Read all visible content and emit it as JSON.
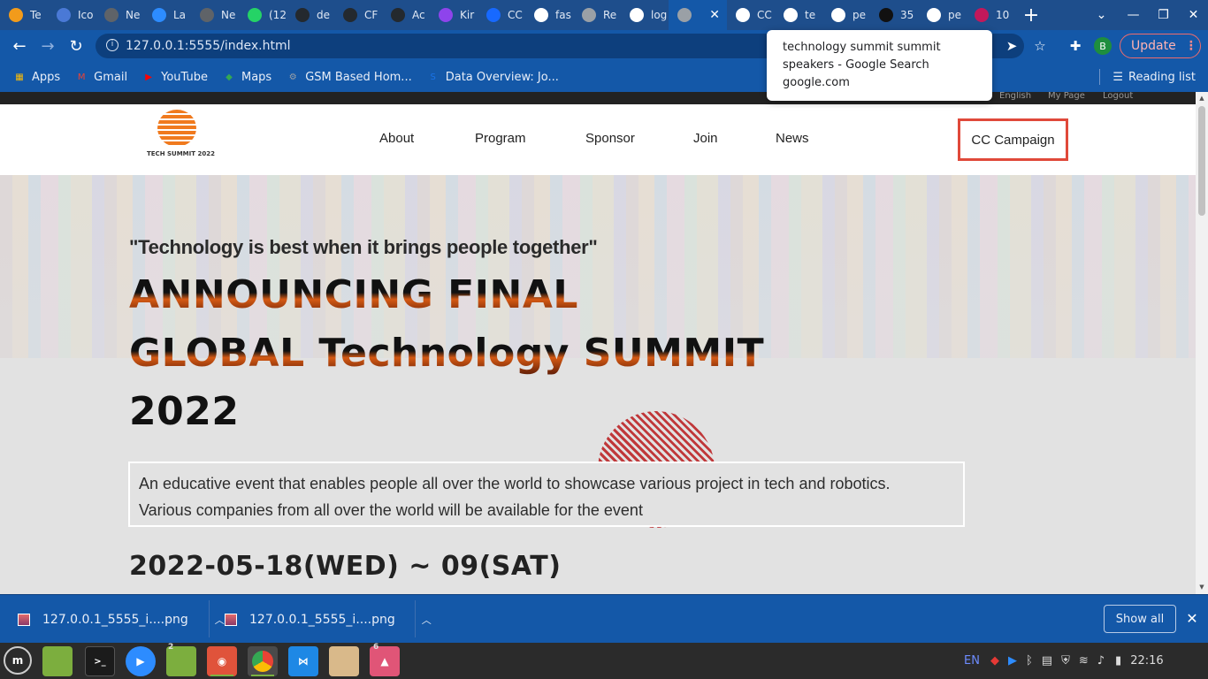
{
  "tabs": [
    {
      "label": "Te",
      "icon": "gear-badge-icon",
      "color": "#f29b1b"
    },
    {
      "label": "Ico",
      "icon": "flag-icon",
      "color": "#4a79d6"
    },
    {
      "label": "Ne",
      "icon": "chrome-icon",
      "color": "#5f6368"
    },
    {
      "label": "La",
      "icon": "zoom-icon",
      "color": "#2d8cff"
    },
    {
      "label": "Ne",
      "icon": "chrome-icon",
      "color": "#5f6368"
    },
    {
      "label": "(12",
      "icon": "whatsapp-icon",
      "color": "#25d366"
    },
    {
      "label": "de",
      "icon": "github-icon",
      "color": "#24292e"
    },
    {
      "label": "CF",
      "icon": "github-icon",
      "color": "#24292e"
    },
    {
      "label": "Ac",
      "icon": "github-icon",
      "color": "#24292e"
    },
    {
      "label": "Kir",
      "icon": "kiwi-icon",
      "color": "#8e44ec"
    },
    {
      "label": "CC",
      "icon": "behance-icon",
      "color": "#1769ff"
    },
    {
      "label": "fas",
      "icon": "google-icon",
      "color": "#ffffff"
    },
    {
      "label": "Re",
      "icon": "layers-icon",
      "color": "#9aa0a6"
    },
    {
      "label": "log",
      "icon": "google-icon",
      "color": "#ffffff"
    },
    {
      "label": "",
      "icon": "radio-icon",
      "color": "#9aa0a6",
      "active": true
    },
    {
      "label": "CC",
      "icon": "globe-icon",
      "color": "#ffffff"
    },
    {
      "label": "te",
      "icon": "google-icon",
      "color": "#ffffff"
    },
    {
      "label": "pe",
      "icon": "google-icon",
      "color": "#ffffff"
    },
    {
      "label": "35",
      "icon": "pixel-icon",
      "color": "#111111"
    },
    {
      "label": "pe",
      "icon": "google-icon",
      "color": "#ffffff"
    },
    {
      "label": "10",
      "icon": "diamond-icon",
      "color": "#c2185b"
    }
  ],
  "address": {
    "url": "127.0.0.1:5555/index.html"
  },
  "toolbar": {
    "update_label": "Update",
    "avatar_initial": "B"
  },
  "bookmarks": [
    {
      "label": "Apps",
      "icon": "apps-grid-icon"
    },
    {
      "label": "Gmail",
      "icon": "gmail-icon"
    },
    {
      "label": "YouTube",
      "icon": "youtube-icon"
    },
    {
      "label": "Maps",
      "icon": "maps-icon"
    },
    {
      "label": "GSM Based Hom...",
      "icon": "gear-icon"
    },
    {
      "label": "Data Overview: Jo...",
      "icon": "sap-icon"
    }
  ],
  "reading_list": "Reading list",
  "tooltip": {
    "line1": "technology summit summit",
    "line2": "speakers - Google Search",
    "line3": "google.com"
  },
  "site": {
    "topbar": {
      "english": "English",
      "mypage": "My Page",
      "logout": "Logout"
    },
    "logo_text": "TECH SUMMIT 2022",
    "nav": [
      "About",
      "Program",
      "Sponsor",
      "Join",
      "News"
    ],
    "cta": "CC Campaign",
    "quote": "\"Technology is best when it brings people together\"",
    "headline_lines": [
      "ANNOUNCING FINAL",
      "GLOBAL Technology SUMMIT",
      "2022"
    ],
    "description_1": "An educative event that enables people all over the world to showcase various project in tech and robotics.",
    "description_2": "Various companies from all over the world will be available for the event",
    "dates": "2022-05-18(WED) ~ 09(SAT)"
  },
  "downloads": {
    "items": [
      "127.0.0.1_5555_i....png",
      "127.0.0.1_5555_i....png"
    ],
    "show_all": "Show all"
  },
  "taskbar": {
    "badge_files": "2",
    "badge_photos": "6",
    "lang": "EN",
    "clock": "22:16"
  },
  "colors": {
    "chrome_blue": "#1458a8",
    "cta_border": "#e0493a",
    "update_border": "#ef6c6c"
  }
}
